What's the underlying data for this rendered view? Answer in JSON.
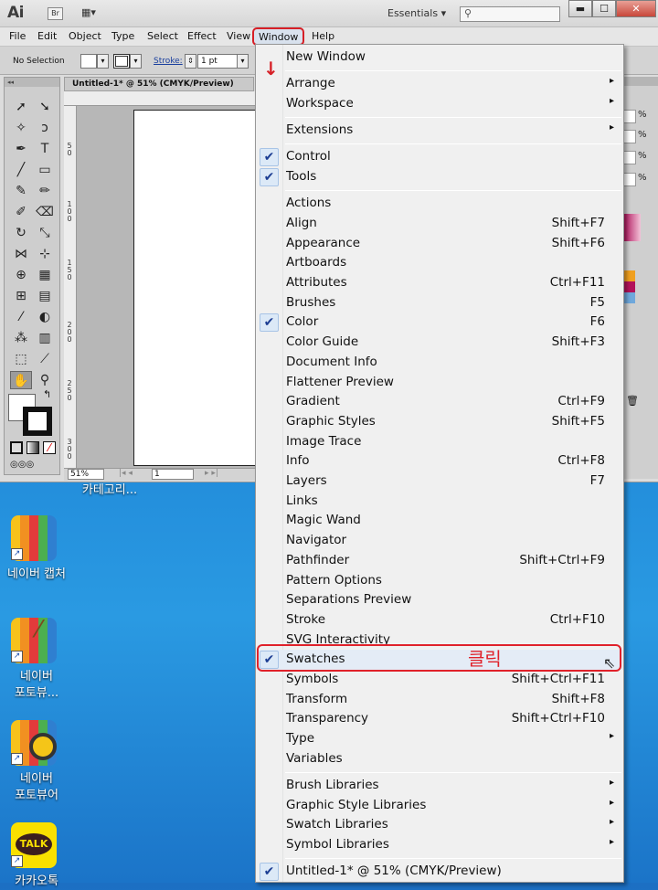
{
  "app": {
    "logo": "Ai",
    "bridge_label": "Br",
    "workspace_label": "Essentials",
    "workspace_arrow": "▾",
    "search_placeholder": "",
    "window_buttons": [
      "▬",
      "☐",
      "✕"
    ]
  },
  "menubar": {
    "items": [
      "File",
      "Edit",
      "Object",
      "Type",
      "Select",
      "Effect",
      "View",
      "Window",
      "Help"
    ],
    "active": "Window"
  },
  "controlbar": {
    "selection_text": "No Selection",
    "stroke_label": "Stroke:",
    "stroke_value": "1 pt"
  },
  "document": {
    "tab_title": "Untitled-1* @ 51% (CMYK/Preview)",
    "zoom_value": "51%",
    "page_value": "1",
    "ruler_left_marks": [
      "5\n0",
      "1\n0\n0",
      "1\n5\n0",
      "2\n0\n0",
      "2\n5\n0",
      "3\n0\n0"
    ]
  },
  "panels": {
    "percent_symbols": [
      "%",
      "%",
      "%",
      "%"
    ]
  },
  "desktop": {
    "icons": [
      {
        "label": "카테고리..."
      },
      {
        "label": "네이버 캡처"
      },
      {
        "label": "네이버\n포토뷰..."
      },
      {
        "label": "네이버\n포토뷰어"
      },
      {
        "label": "카카오톡",
        "logo_text": "TALK"
      }
    ]
  },
  "window_menu": {
    "groups": [
      [
        {
          "label": "New Window"
        }
      ],
      [
        {
          "label": "Arrange",
          "submenu": true
        },
        {
          "label": "Workspace",
          "submenu": true
        }
      ],
      [
        {
          "label": "Extensions",
          "submenu": true
        }
      ],
      [
        {
          "label": "Control",
          "checked": true
        },
        {
          "label": "Tools",
          "checked": true
        }
      ],
      [
        {
          "label": "Actions"
        },
        {
          "label": "Align",
          "shortcut": "Shift+F7"
        },
        {
          "label": "Appearance",
          "shortcut": "Shift+F6"
        },
        {
          "label": "Artboards"
        },
        {
          "label": "Attributes",
          "shortcut": "Ctrl+F11"
        },
        {
          "label": "Brushes",
          "shortcut": "F5"
        },
        {
          "label": "Color",
          "shortcut": "F6",
          "checked": true
        },
        {
          "label": "Color Guide",
          "shortcut": "Shift+F3"
        },
        {
          "label": "Document Info"
        },
        {
          "label": "Flattener Preview"
        },
        {
          "label": "Gradient",
          "shortcut": "Ctrl+F9"
        },
        {
          "label": "Graphic Styles",
          "shortcut": "Shift+F5"
        },
        {
          "label": "Image Trace"
        },
        {
          "label": "Info",
          "shortcut": "Ctrl+F8"
        },
        {
          "label": "Layers",
          "shortcut": "F7"
        },
        {
          "label": "Links"
        },
        {
          "label": "Magic Wand"
        },
        {
          "label": "Navigator"
        },
        {
          "label": "Pathfinder",
          "shortcut": "Shift+Ctrl+F9"
        },
        {
          "label": "Pattern Options"
        },
        {
          "label": "Separations Preview"
        },
        {
          "label": "Stroke",
          "shortcut": "Ctrl+F10"
        },
        {
          "label": "SVG Interactivity"
        },
        {
          "label": "Swatches",
          "checked": true,
          "highlighted": true
        },
        {
          "label": "Symbols",
          "shortcut": "Shift+Ctrl+F11"
        },
        {
          "label": "Transform",
          "shortcut": "Shift+F8"
        },
        {
          "label": "Transparency",
          "shortcut": "Shift+Ctrl+F10"
        },
        {
          "label": "Type",
          "submenu": true
        },
        {
          "label": "Variables"
        }
      ],
      [
        {
          "label": "Brush Libraries",
          "submenu": true
        },
        {
          "label": "Graphic Style Libraries",
          "submenu": true
        },
        {
          "label": "Swatch Libraries",
          "submenu": true
        },
        {
          "label": "Symbol Libraries",
          "submenu": true
        }
      ],
      [
        {
          "label": "Untitled-1* @ 51% (CMYK/Preview)",
          "checked": true
        }
      ]
    ],
    "submenu_arrow": "▸",
    "check_glyph": "✔"
  },
  "annotation": {
    "click_text": "클릭",
    "arrow_glyph": "↓"
  }
}
